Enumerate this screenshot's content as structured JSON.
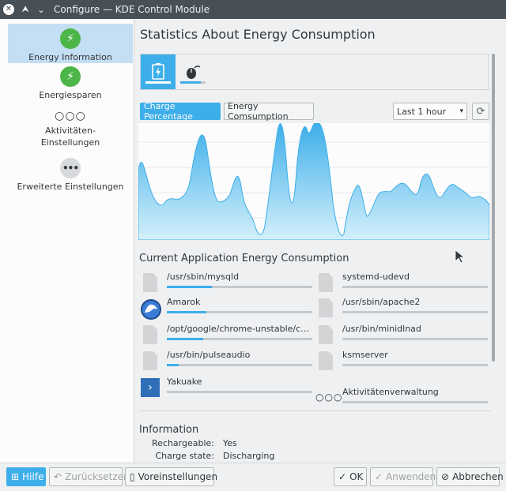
{
  "window": {
    "title": "Configure — KDE Control Module"
  },
  "sidebar": {
    "items": [
      {
        "label": "Energy Information"
      },
      {
        "label": "Energiesparen"
      },
      {
        "label": "Aktivitäten-Einstellungen"
      },
      {
        "label": "Erweiterte Einstellungen"
      }
    ]
  },
  "main": {
    "title": "Statistics About Energy Consumption",
    "graph_tabs": [
      {
        "icon": "battery-icon",
        "active": true
      },
      {
        "icon": "mouse-icon",
        "active": false,
        "level": 0.8
      }
    ],
    "toggle_charge": "Charge Percentage",
    "toggle_energy": "Energy Comsumption",
    "range_select": "Last 1 hour",
    "apps_title": "Current Application Energy Consumption",
    "apps_left": [
      {
        "name": "/usr/sbin/mysqld",
        "icon": "file-icon",
        "usage": 0.31
      },
      {
        "name": "Amarok",
        "icon": "amarok-icon",
        "usage": 0.27
      },
      {
        "name": "/opt/google/chrome-unstable/ch...",
        "icon": "file-icon",
        "usage": 0.25
      },
      {
        "name": "/usr/bin/pulseaudio",
        "icon": "file-icon",
        "usage": 0.08
      },
      {
        "name": "Yakuake",
        "icon": "yakuake-icon",
        "usage": 0.0
      }
    ],
    "apps_right": [
      {
        "name": "systemd-udevd",
        "icon": "file-icon",
        "usage": 0.0
      },
      {
        "name": "/usr/sbin/apache2",
        "icon": "file-icon",
        "usage": 0.0
      },
      {
        "name": "/usr/bin/minidlnad",
        "icon": "file-icon",
        "usage": 0.0
      },
      {
        "name": "ksmserver",
        "icon": "file-icon",
        "usage": 0.0
      },
      {
        "name": "Aktivitätenverwaltung",
        "icon": "dots-icon",
        "usage": 0.0
      }
    ],
    "info_title": "Information",
    "info": [
      {
        "label": "Rechargeable:",
        "value": "Yes"
      },
      {
        "label": "Charge state:",
        "value": "Discharging"
      }
    ]
  },
  "buttons": {
    "help": "Hilfe",
    "reset": "Zurücksetzen",
    "defaults": "Voreinstellungen",
    "ok": "OK",
    "apply": "Anwenden",
    "cancel": "Abbrechen"
  },
  "colors": {
    "accent": "#3daee9",
    "graph_fill_top": "#3daee9",
    "graph_fill_bottom": "#d4f0fb"
  }
}
